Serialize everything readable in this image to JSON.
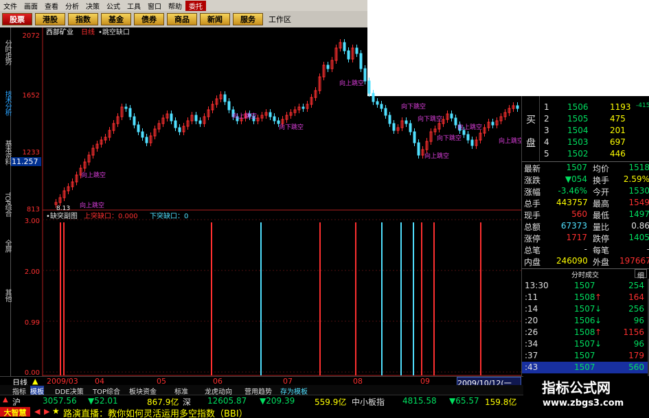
{
  "menu": {
    "items": [
      "文件",
      "画面",
      "查看",
      "分析",
      "决策",
      "公式",
      "工具",
      "窗口",
      "帮助",
      "委托"
    ]
  },
  "toolbar": {
    "buttons": [
      "股票",
      "港股",
      "指数",
      "基金",
      "债券",
      "商品",
      "新闻",
      "服务"
    ],
    "workzone": "工作区"
  },
  "left_tabs": [
    "分时走势",
    "技术分析",
    "基本资料",
    "TOP综合",
    "全屏",
    "其他"
  ],
  "chart": {
    "stock_name": "西部矿业",
    "period": "日线",
    "indicator": "•跳空缺口",
    "price_axis": [
      "2072",
      "1652",
      "1233",
      "813"
    ],
    "current_price_tag": "11.257",
    "low_label": "8.13",
    "gap_up_label": "向上跳空",
    "gap_down_label": "向下跳空",
    "sub_title": "•缺突副图",
    "sub_gap_up": "上突缺口：0.000",
    "sub_gap_down": "下突缺口：0",
    "sub_axis": [
      "3.00",
      "2.00",
      "0.99",
      "0.00"
    ],
    "time_axis": [
      "2009/03",
      "04",
      "05",
      "06",
      "07",
      "08",
      "09"
    ],
    "date_box": "2009/10/12(一"
  },
  "chart_data": {
    "type": "candlestick",
    "title": "西部矿业 日线",
    "price_ticks": [
      2072,
      1652,
      1233,
      813
    ],
    "sub_ticks": [
      3.0,
      2.0,
      0.99,
      0.0
    ]
  },
  "orderbook": {
    "side_label_1": "买",
    "side_label_2": "盘",
    "levels": [
      {
        "n": "1",
        "price": "1506",
        "vol": "1193",
        "extra": "-415"
      },
      {
        "n": "2",
        "price": "1505",
        "vol": "475",
        "extra": ""
      },
      {
        "n": "3",
        "price": "1504",
        "vol": "201",
        "extra": ""
      },
      {
        "n": "4",
        "price": "1503",
        "vol": "697",
        "extra": ""
      },
      {
        "n": "5",
        "price": "1502",
        "vol": "446",
        "extra": ""
      }
    ]
  },
  "quote": [
    {
      "l1": "最新",
      "v1": "1507",
      "l2": "均价",
      "v2": "1518"
    },
    {
      "l1": "涨跌",
      "v1": "▼054",
      "l2": "换手",
      "v2": "2.59%"
    },
    {
      "l1": "涨幅",
      "v1": "-3.46%",
      "l2": "今开",
      "v2": "1530"
    },
    {
      "l1": "总手",
      "v1": "443757",
      "l2": "最高",
      "v2": "1549"
    },
    {
      "l1": "现手",
      "v1": "560",
      "l2": "最低",
      "v2": "1497"
    },
    {
      "l1": "总额",
      "v1": "67373",
      "l2": "量比",
      "v2": "0.86"
    },
    {
      "l1": "涨停",
      "v1": "1717",
      "l2": "跌停",
      "v2": "1405"
    },
    {
      "l1": "总笔",
      "v1": "-",
      "l2": "每笔",
      "v2": "-"
    },
    {
      "l1": "内盘",
      "v1": "246090",
      "l2": "外盘",
      "v2": "197667"
    }
  ],
  "ticks": {
    "header": "分时成交",
    "tab": "细",
    "rows": [
      {
        "t": "13:30",
        "p": "1507",
        "a": "",
        "v": "254",
        "vc": "green"
      },
      {
        "t": ":11",
        "p": "1508",
        "a": "↑",
        "v": "164",
        "vc": "red"
      },
      {
        "t": ":14",
        "p": "1507",
        "a": "↓",
        "v": "256",
        "vc": "green"
      },
      {
        "t": ":20",
        "p": "1506",
        "a": "↓",
        "v": "96",
        "vc": "green"
      },
      {
        "t": ":26",
        "p": "1508",
        "a": "↑",
        "v": "1156",
        "vc": "red"
      },
      {
        "t": ":34",
        "p": "1507",
        "a": "↓",
        "v": "96",
        "vc": "green"
      },
      {
        "t": ":37",
        "p": "1507",
        "a": "",
        "v": "179",
        "vc": "red"
      },
      {
        "t": ":43",
        "p": "1507",
        "a": "",
        "v": "560",
        "vc": "green"
      }
    ]
  },
  "bottom_tabs": {
    "period_label": "日线",
    "tabs": [
      "指标",
      "模板",
      "DDE决策",
      "TOP综合",
      "板块资金",
      "标准",
      "龙虎动向",
      "营用趋势",
      "存为模板"
    ]
  },
  "index_bar": {
    "sh_label": "沪",
    "sh_val": "3057.56",
    "sh_chg": "▼52.01",
    "sh_amt": "867.9亿",
    "sz_label": "深",
    "sz_val": "12605.87",
    "sz_chg": "▼209.39",
    "sz_amt": "559.9亿",
    "sme_label": "中小板指",
    "sme_val": "4815.58",
    "sme_chg": "▼65.57",
    "sme_amt": "159.8亿"
  },
  "ticker": {
    "brand": "大智慧",
    "text": "路演直播：教你如何灵活运用多空指数（BBI）"
  },
  "watermark": {
    "line1": "指标公式网",
    "line2": "www.zbgs3.com"
  }
}
